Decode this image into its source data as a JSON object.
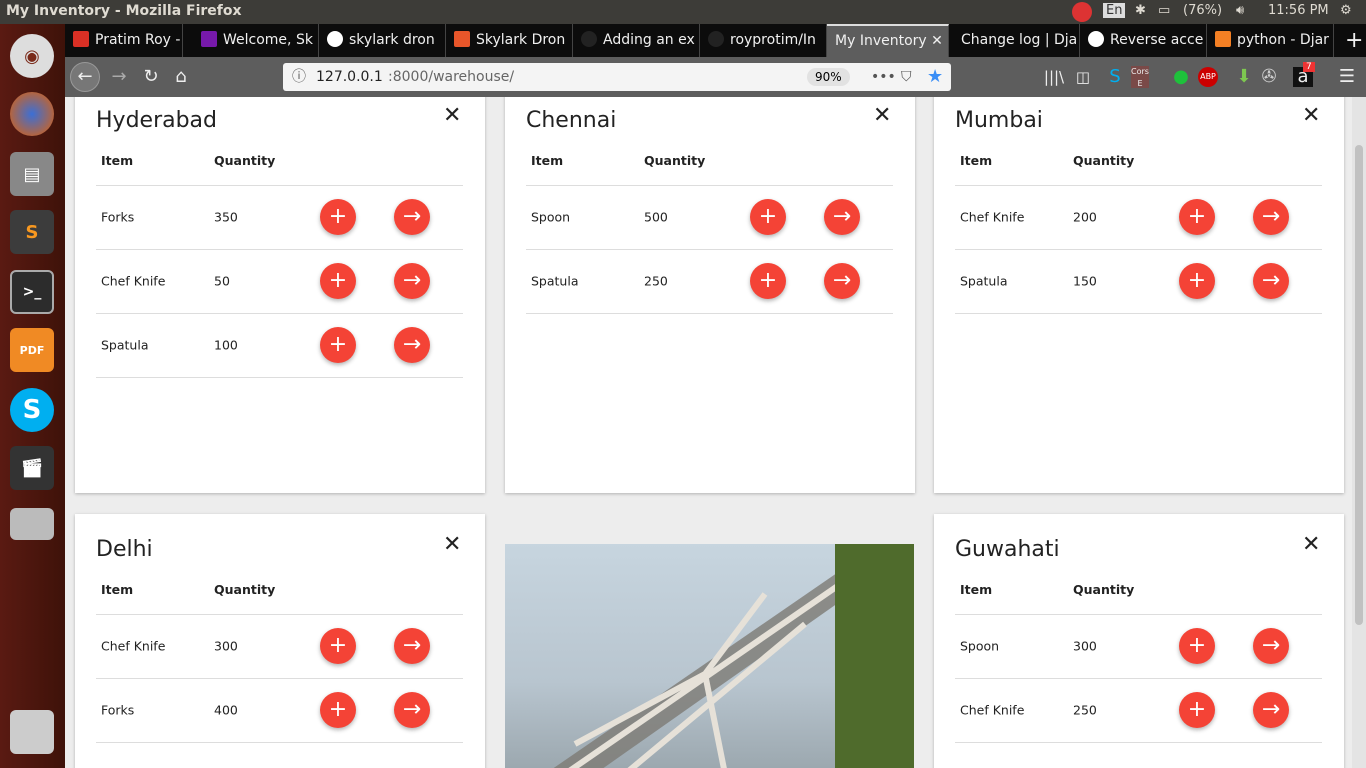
{
  "window": {
    "title": "My Inventory - Mozilla Firefox"
  },
  "system": {
    "keyboard": "En",
    "battery": "(76%)",
    "time": "11:56 PM"
  },
  "tabs": [
    {
      "label": "Pratim Roy -",
      "color": "#d93025"
    },
    {
      "label": "Welcome, Sk",
      "color": "#7719aa"
    },
    {
      "label": "skylark dron",
      "color": "#4285f4"
    },
    {
      "label": "Skylark Dron",
      "color": "#e8562a"
    },
    {
      "label": "Adding an ex",
      "color": "#222"
    },
    {
      "label": "royprotim/In",
      "color": "#222"
    },
    {
      "label": "My Inventory",
      "color": "",
      "active": true
    },
    {
      "label": "Change log | Dja",
      "color": ""
    },
    {
      "label": "Reverse acce",
      "color": "#4285f4"
    },
    {
      "label": "python - Djar",
      "color": "#f48024"
    }
  ],
  "nav": {
    "url_host": "127.0.0.1",
    "url_rest": ":8000/warehouse/",
    "zoom": "90%",
    "badge": "7",
    "ext_cors": "Cors E",
    "ext_abp": "ABP"
  },
  "table_headers": {
    "item": "Item",
    "quantity": "Quantity"
  },
  "warehouses": [
    {
      "name": "Hyderabad",
      "rows": [
        {
          "item": "Forks",
          "qty": "350"
        },
        {
          "item": "Chef Knife",
          "qty": "50"
        },
        {
          "item": "Spatula",
          "qty": "100"
        }
      ]
    },
    {
      "name": "Chennai",
      "rows": [
        {
          "item": "Spoon",
          "qty": "500"
        },
        {
          "item": "Spatula",
          "qty": "250"
        }
      ]
    },
    {
      "name": "Mumbai",
      "rows": [
        {
          "item": "Chef Knife",
          "qty": "200"
        },
        {
          "item": "Spatula",
          "qty": "150"
        }
      ]
    },
    {
      "name": "Delhi",
      "rows": [
        {
          "item": "Chef Knife",
          "qty": "300"
        },
        {
          "item": "Forks",
          "qty": "400"
        }
      ]
    },
    {
      "name": "Guwahati",
      "rows": [
        {
          "item": "Spoon",
          "qty": "300"
        },
        {
          "item": "Chef Knife",
          "qty": "250"
        }
      ]
    }
  ],
  "colors": {
    "accent": "#f44336"
  }
}
